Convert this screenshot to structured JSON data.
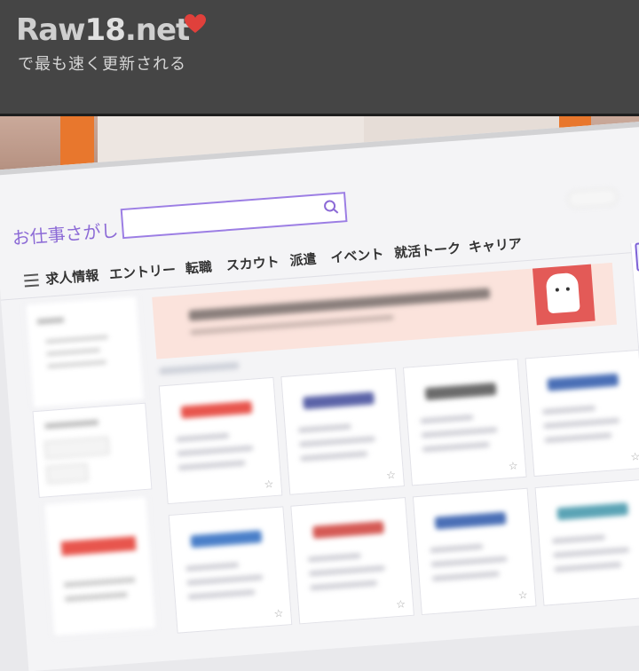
{
  "banner": {
    "logo_main": "Raw",
    "logo_number": "18",
    "logo_suffix": ".net",
    "tagline": "で最も速く更新される",
    "heart_color": "#e0403b"
  },
  "site": {
    "title": "お仕事さがし",
    "search_placeholder": "",
    "accent_color": "#8c6ad6"
  },
  "nav": {
    "items": [
      {
        "label": "求人情報"
      },
      {
        "label": "エントリー"
      },
      {
        "label": "転職"
      },
      {
        "label": "スカウト"
      },
      {
        "label": "派遣"
      },
      {
        "label": "イベント"
      },
      {
        "label": "就活トーク"
      },
      {
        "label": "キャリア"
      }
    ]
  },
  "job_cards": [
    {
      "logo_color": "#e8554d"
    },
    {
      "logo_color": "#5b63a8"
    },
    {
      "logo_color": "#6b6b6b"
    },
    {
      "logo_color": "#4a6fb6"
    },
    {
      "logo_color": "#4a7fc9"
    },
    {
      "logo_color": "#d55a55"
    },
    {
      "logo_color": "#4a6fb6"
    },
    {
      "logo_color": "#5aa3b5"
    }
  ]
}
